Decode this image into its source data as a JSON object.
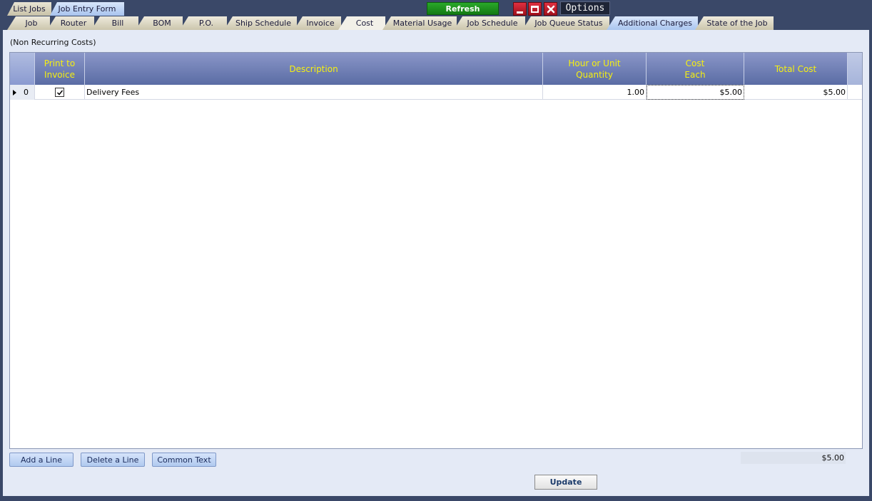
{
  "top": {
    "tabs": [
      {
        "label": "List Jobs",
        "active": false
      },
      {
        "label": "Job Entry Form",
        "active": true
      }
    ],
    "refresh_label": "Refresh",
    "options_label": "Options"
  },
  "tabs": [
    {
      "label": "Job"
    },
    {
      "label": "Router"
    },
    {
      "label": "Bill"
    },
    {
      "label": "BOM"
    },
    {
      "label": "P.O."
    },
    {
      "label": "Ship Schedule"
    },
    {
      "label": "Invoice"
    },
    {
      "label": "Cost"
    },
    {
      "label": "Material Usage"
    },
    {
      "label": "Job Schedule"
    },
    {
      "label": "Job Queue Status"
    },
    {
      "label": "Additional Charges"
    },
    {
      "label": "State of the Job"
    }
  ],
  "selected_tab": "Additional Charges",
  "section_label": "(Non Recurring Costs)",
  "grid": {
    "columns": [
      {
        "label": "Print to\nInvoice"
      },
      {
        "label": "Description"
      },
      {
        "label": "Hour or Unit\nQuantity"
      },
      {
        "label": "Cost\nEach"
      },
      {
        "label": "Total Cost"
      }
    ],
    "rows": [
      {
        "index": "0",
        "print_to_invoice": true,
        "description": "Delivery Fees",
        "quantity": "1.00",
        "cost_each": "$5.00",
        "total_cost": "$5.00"
      }
    ]
  },
  "buttons": {
    "add_line": "Add a Line",
    "delete_line": "Delete a Line",
    "common_text": "Common Text",
    "update": "Update"
  },
  "grand_total": "$5.00",
  "colors": {
    "header_text": "#f6f010",
    "refresh_bg": "#1f911f",
    "window_buttons": "#c81a2a"
  }
}
